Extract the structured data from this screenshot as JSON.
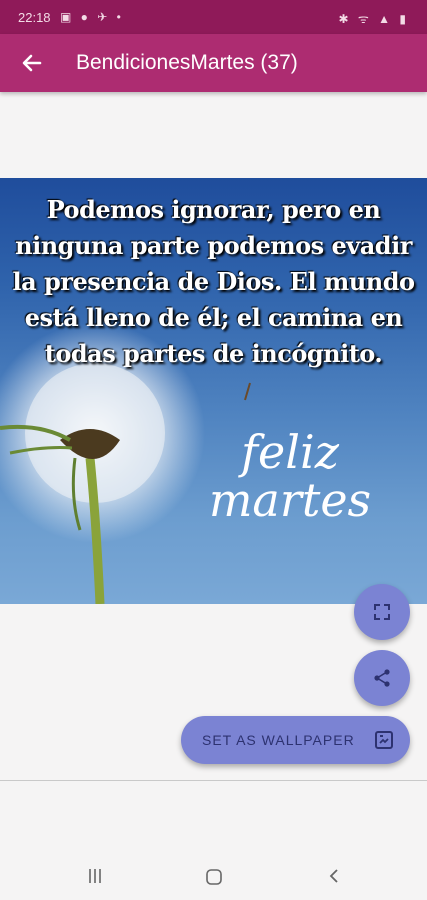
{
  "status_bar": {
    "time": "22:18",
    "left_icons": "▣ ● ✈ •",
    "right_icons": "✱ ᯤ ▲ ▮"
  },
  "app_bar": {
    "title": "BendicionesMartes (37)"
  },
  "image": {
    "quote": "Podemos ignorar, pero en ninguna parte podemos evadir la presencia de Dios. El mundo está lleno de él; el camina en todas partes de incógnito.",
    "overlay_line1": "feliz",
    "overlay_line2": "martes"
  },
  "actions": {
    "set_wallpaper_label": "SET AS WALLPAPER"
  },
  "colors": {
    "status_bar": "#8f1a59",
    "app_bar": "#ad2c71",
    "fab": "#7b83d3"
  }
}
